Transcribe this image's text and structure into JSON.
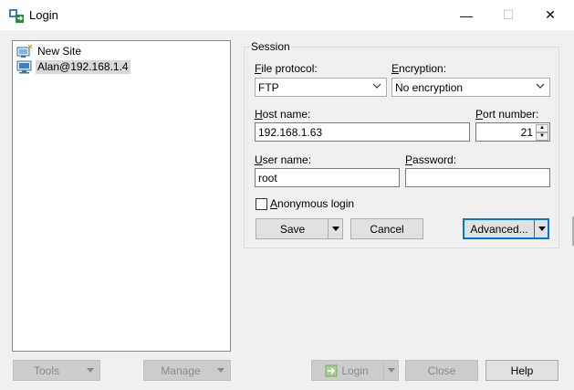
{
  "window": {
    "title": "Login",
    "icon": "login-app-icon",
    "controls": {
      "minimize": "—",
      "maximize": "☐",
      "close": "✕"
    }
  },
  "sites": {
    "items": [
      {
        "label": "New Site",
        "icon": "new-site-icon",
        "selected": false
      },
      {
        "label": "Alan@192.168.1.4",
        "icon": "computer-icon",
        "selected": true
      }
    ]
  },
  "session": {
    "group_label": "Session",
    "file_protocol": {
      "label_prefix": "",
      "label_accel": "F",
      "label_rest": "ile protocol:",
      "value": "FTP"
    },
    "encryption": {
      "label_accel": "E",
      "label_rest": "ncryption:",
      "value": "No encryption"
    },
    "host_name": {
      "label_accel": "H",
      "label_rest": "ost name:",
      "value": "192.168.1.63"
    },
    "port_number": {
      "label_accel": "P",
      "label_rest": "ort number:",
      "value": "21"
    },
    "user_name": {
      "label_accel": "U",
      "label_rest": "ser name:",
      "value": "root"
    },
    "password": {
      "label_accel": "P",
      "label_rest": "assword:",
      "value": ""
    },
    "anonymous_login": {
      "label_accel": "A",
      "label_rest": "nonymous login",
      "checked": false
    },
    "save_label": "Save",
    "cancel_label": "Cancel",
    "advanced_label": "Advanced..."
  },
  "footer": {
    "tools_label": "Tools",
    "manage_label": "Manage",
    "login_label": "Login",
    "close_label": "Close",
    "help_label": "Help"
  },
  "colors": {
    "focus_blue": "#0078d7",
    "button_face": "#e1e1e1",
    "selection": "#d9d9d9"
  }
}
